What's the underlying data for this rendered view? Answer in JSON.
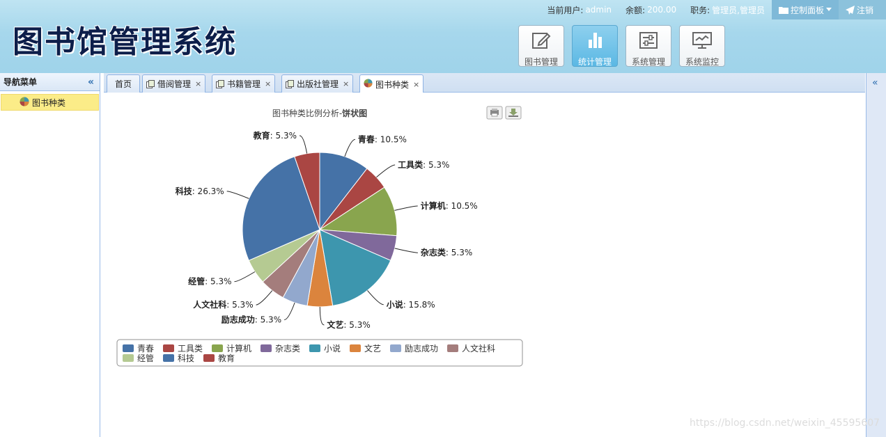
{
  "app": {
    "title": "图书馆管理系统"
  },
  "userbar": {
    "current_user_label": "当前用户:",
    "current_user": "admin",
    "balance_label": "余额:",
    "balance": "200.00",
    "role_label": "职务:",
    "role": "管理员,管理员",
    "control_panel": "控制面板",
    "logout": "注销"
  },
  "modules": [
    {
      "label": "图书管理",
      "icon": "edit-icon",
      "active": false
    },
    {
      "label": "统计管理",
      "icon": "bar-chart-icon",
      "active": true
    },
    {
      "label": "系统管理",
      "icon": "settings-panel-icon",
      "active": false
    },
    {
      "label": "系统监控",
      "icon": "monitor-icon",
      "active": false
    }
  ],
  "nav": {
    "title": "导航菜单",
    "items": [
      {
        "label": "图书种类",
        "icon": "pie-chart-icon",
        "selected": true
      }
    ]
  },
  "tabs": [
    {
      "label": "首页",
      "closable": false,
      "active": false
    },
    {
      "label": "借阅管理",
      "closable": true,
      "active": false
    },
    {
      "label": "书籍管理",
      "closable": true,
      "active": false
    },
    {
      "label": "出版社管理",
      "closable": true,
      "active": false
    },
    {
      "label": "图书种类",
      "closable": true,
      "active": true
    }
  ],
  "chart_data": {
    "type": "pie",
    "title": "图书种类比例分析-",
    "title_bold": "饼状图",
    "categories": [
      "青春",
      "工具类",
      "计算机",
      "杂志类",
      "小说",
      "文艺",
      "励志成功",
      "人文社科",
      "经管",
      "科技",
      "教育"
    ],
    "values": [
      10.5,
      5.3,
      10.5,
      5.3,
      15.8,
      5.3,
      5.3,
      5.3,
      5.3,
      26.3,
      5.3
    ],
    "unit": "%",
    "colors": [
      "#4572a7",
      "#aa4643",
      "#89a54e",
      "#80699b",
      "#3d96ae",
      "#db843d",
      "#92a8cd",
      "#a47d7c",
      "#b5ca92",
      "#4572a7",
      "#aa4643"
    ],
    "legend_position": "bottom",
    "toolbar": [
      "print-icon",
      "download-icon"
    ]
  },
  "watermark": "https://blog.csdn.net/weixin_45595607"
}
